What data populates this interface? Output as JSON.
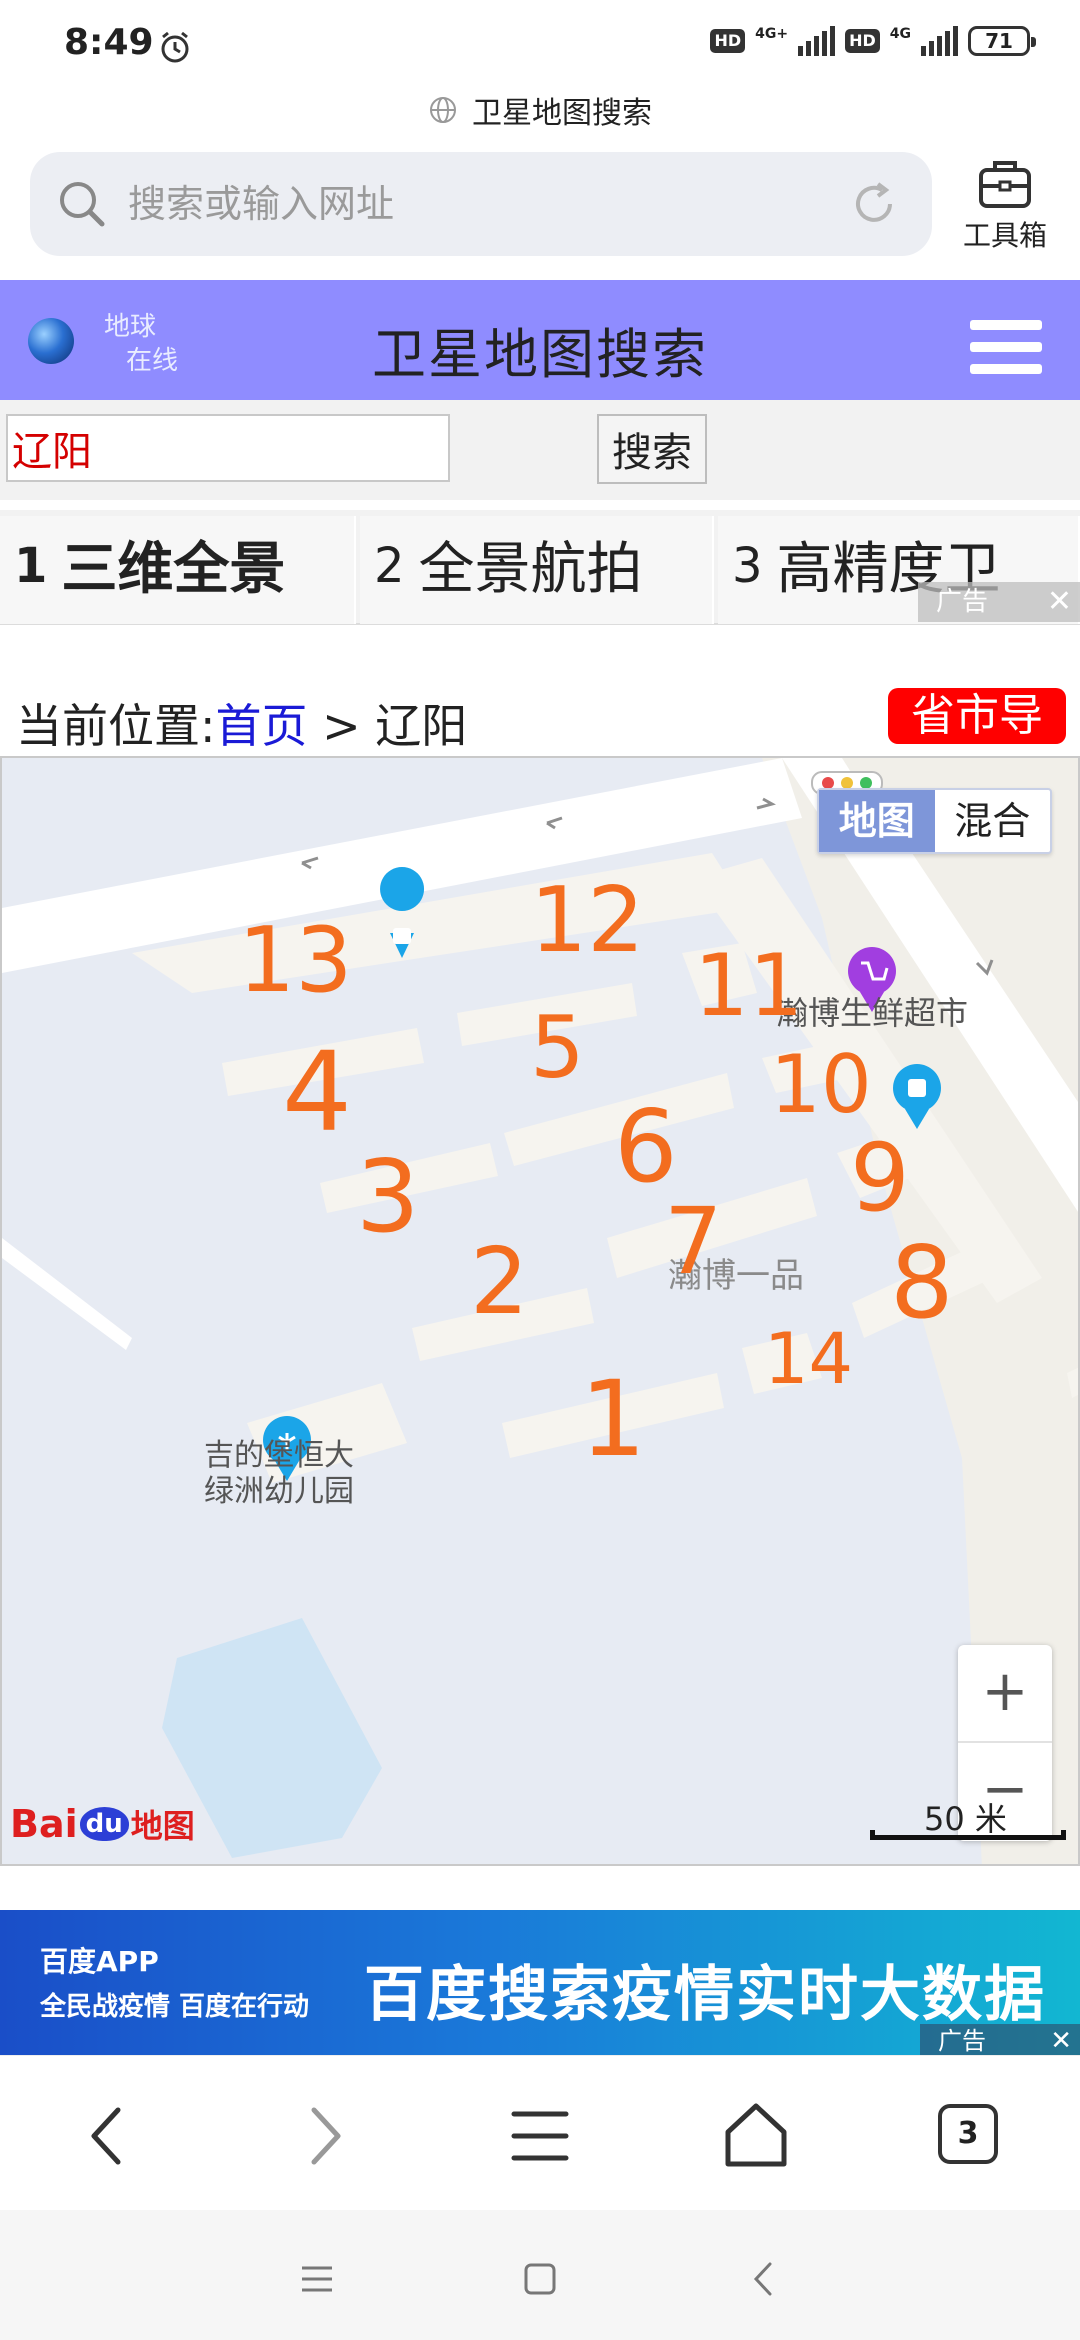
{
  "status_bar": {
    "time": "8:49",
    "hd1": "HD",
    "net1": "4G+",
    "hd2": "HD",
    "net2": "4G",
    "battery": "71"
  },
  "page_title": "卫星地图搜索",
  "url_bar": {
    "placeholder": "搜索或输入网址"
  },
  "toolbox_label": "工具箱",
  "site_header": {
    "logo_line1": "地球",
    "logo_line2": "在线",
    "title": "卫星地图搜索"
  },
  "search": {
    "city_value": "辽阳",
    "button_label": "搜索"
  },
  "tabs": [
    {
      "num": "1",
      "label": "三维全景"
    },
    {
      "num": "2",
      "label": "全景航拍"
    },
    {
      "num": "3",
      "label": "高精度卫"
    }
  ],
  "ad_tag_top": "广告",
  "breadcrumb": {
    "prefix": "当前位置:",
    "home": "首页",
    "separator": ">",
    "current": "辽阳"
  },
  "province_nav_label": "省市导",
  "map": {
    "type_map": "地图",
    "type_hybrid": "混合",
    "poi_supermarket": "瀚博生鲜超市",
    "poi_community": "瀚博一品",
    "poi_kindergarten_line1": "吉的堡恒大",
    "poi_kindergarten_line2": "绿洲幼儿园",
    "zoom_in": "+",
    "zoom_out": "−",
    "scale": "50 米",
    "logo_bai": "Bai",
    "logo_du": "du",
    "logo_ditu": "地图",
    "annotations": [
      "13",
      "12",
      "11",
      "5",
      "4",
      "10",
      "6",
      "9",
      "3",
      "7",
      "2",
      "8",
      "14",
      "1"
    ]
  },
  "ad_banner": {
    "brand": "百度APP",
    "slogan": "全民战疫情 百度在行动",
    "headline": "百度搜索疫情实时大数据",
    "tag": "广告"
  },
  "browser_nav": {
    "tab_count": "3"
  }
}
